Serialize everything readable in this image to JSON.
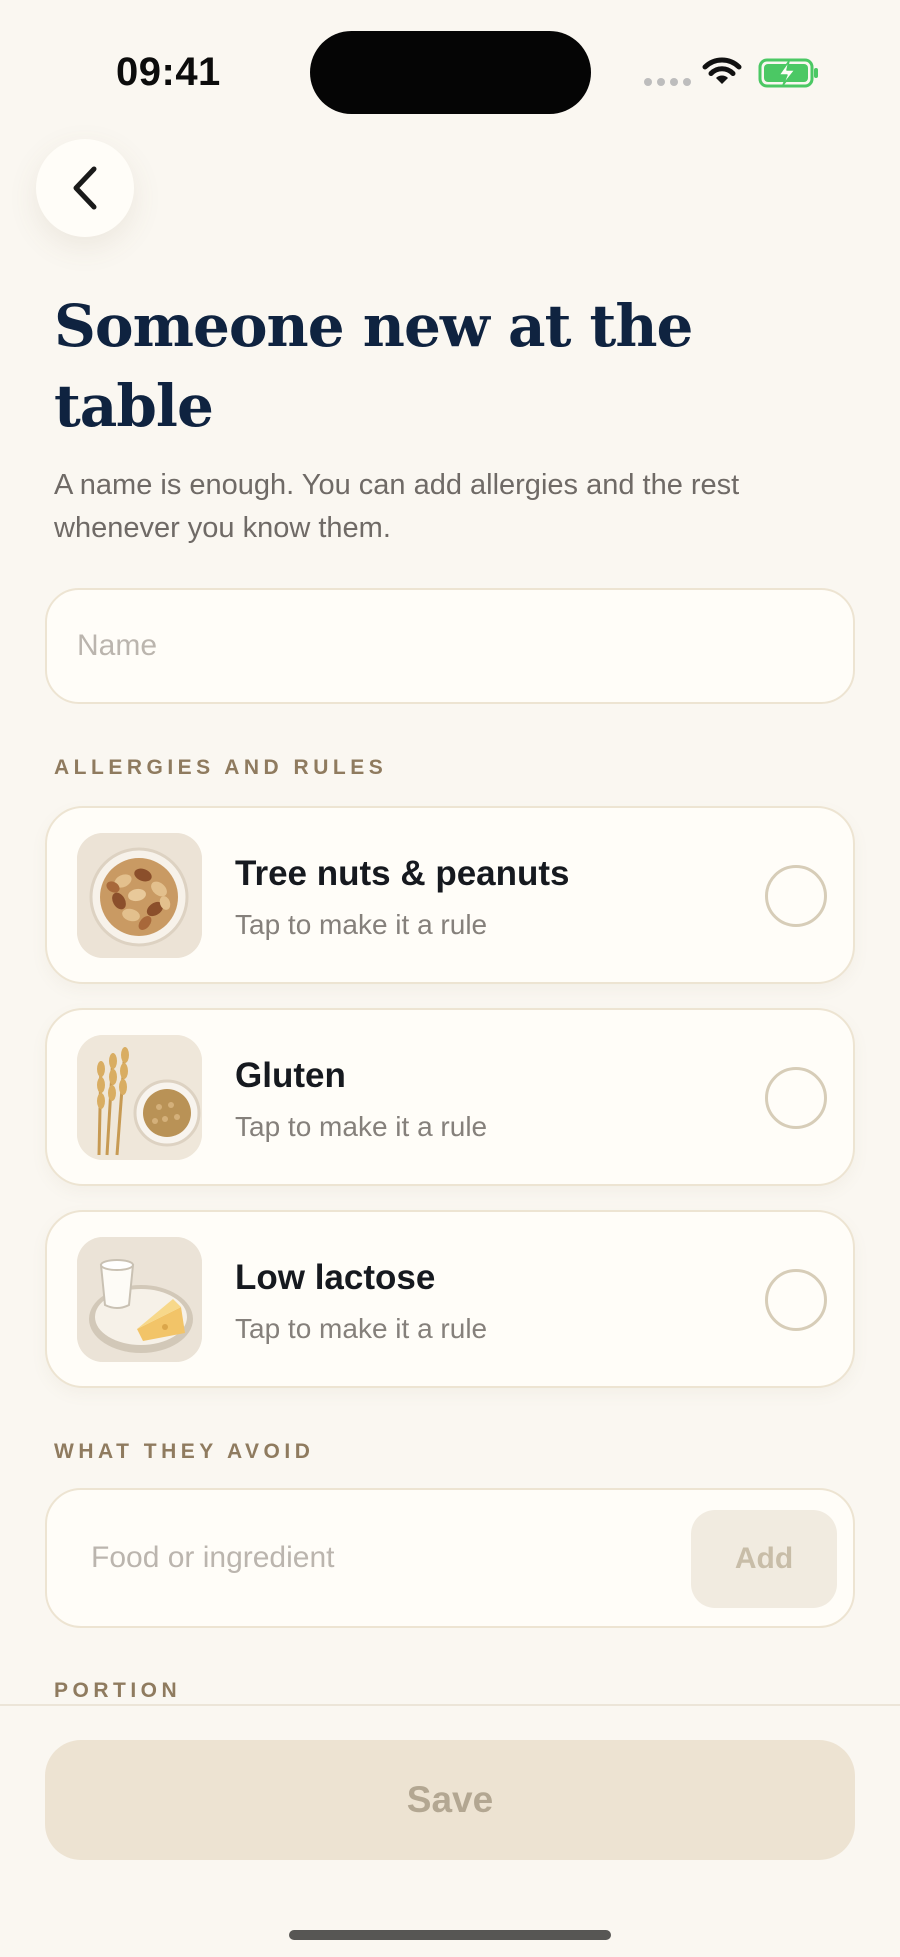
{
  "status_bar": {
    "time": "09:41"
  },
  "header": {
    "title": "Someone new at the table",
    "subtitle": "A name is enough. You can add allergies and the rest whenever you know them."
  },
  "name_field": {
    "placeholder": "Name",
    "value": ""
  },
  "sections": {
    "allergies": "ALLERGIES AND RULES",
    "avoid": "WHAT THEY AVOID",
    "portion": "PORTION"
  },
  "rules": [
    {
      "title": "Tree nuts & peanuts",
      "hint": "Tap to make it a rule",
      "icon": "nuts-bowl-icon",
      "selected": false
    },
    {
      "title": "Gluten",
      "hint": "Tap to make it a rule",
      "icon": "wheat-grain-icon",
      "selected": false
    },
    {
      "title": "Low lactose",
      "hint": "Tap to make it a rule",
      "icon": "milk-cheese-icon",
      "selected": false
    }
  ],
  "avoid_field": {
    "placeholder": "Food or ingredient",
    "add_label": "Add"
  },
  "footer": {
    "save_label": "Save"
  },
  "colors": {
    "background": "#faf7f1",
    "title": "#0f2340",
    "section_label": "#8f7b5f",
    "radio_border": "#d7cdb8",
    "save_disabled_bg": "#ede3d2",
    "battery_green": "#4bc864"
  }
}
